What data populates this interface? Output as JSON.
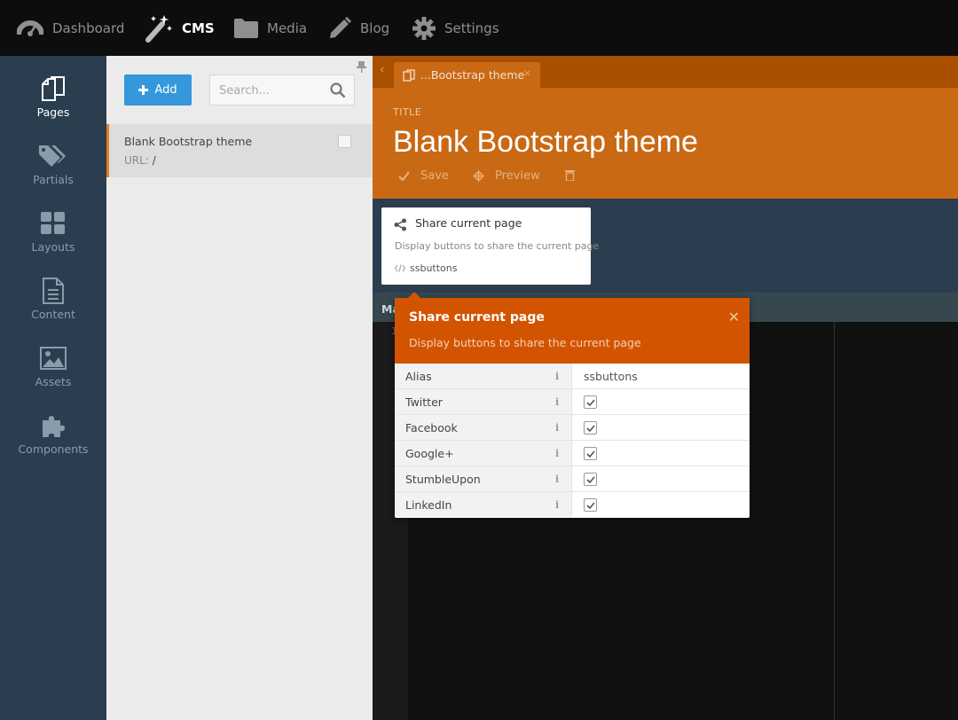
{
  "topnav": {
    "items": [
      {
        "label": "Dashboard",
        "icon": "dashboard-icon"
      },
      {
        "label": "CMS",
        "icon": "magic-wand-icon"
      },
      {
        "label": "Media",
        "icon": "folder-icon"
      },
      {
        "label": "Blog",
        "icon": "pencil-icon"
      },
      {
        "label": "Settings",
        "icon": "gear-icon"
      }
    ],
    "active": "CMS"
  },
  "sidebar": {
    "items": [
      {
        "label": "Pages",
        "icon": "pages-icon"
      },
      {
        "label": "Partials",
        "icon": "tags-icon"
      },
      {
        "label": "Layouts",
        "icon": "grid-icon"
      },
      {
        "label": "Content",
        "icon": "document-icon"
      },
      {
        "label": "Assets",
        "icon": "image-icon"
      },
      {
        "label": "Components",
        "icon": "puzzle-icon"
      }
    ],
    "active": "Pages"
  },
  "pages_panel": {
    "add_label": "Add",
    "search_placeholder": "Search...",
    "pages": [
      {
        "title": "Blank Bootstrap theme",
        "url_label": "URL:",
        "url": "/"
      }
    ]
  },
  "editor": {
    "tab_label": "...Bootstrap theme",
    "title_label": "TITLE",
    "title": "Blank Bootstrap theme",
    "toolbar": {
      "save": "Save",
      "preview": "Preview"
    },
    "markup_tab": "Ma",
    "line_number": "1"
  },
  "component": {
    "title": "Share current page",
    "description": "Display buttons to share the current page",
    "alias": "ssbuttons"
  },
  "inspector": {
    "title": "Share current page",
    "description": "Display buttons to share the current page",
    "info_glyph": "i",
    "properties": [
      {
        "name": "Alias",
        "type": "text",
        "value": "ssbuttons"
      },
      {
        "name": "Twitter",
        "type": "checkbox",
        "checked": true
      },
      {
        "name": "Facebook",
        "type": "checkbox",
        "checked": true
      },
      {
        "name": "Google+",
        "type": "checkbox",
        "checked": true
      },
      {
        "name": "StumbleUpon",
        "type": "checkbox",
        "checked": true
      },
      {
        "name": "LinkedIn",
        "type": "checkbox",
        "checked": true
      }
    ]
  },
  "colors": {
    "accent": "#d35400",
    "header": "#c96914",
    "sidebar": "#2b3e50",
    "add_button": "#3498db"
  }
}
